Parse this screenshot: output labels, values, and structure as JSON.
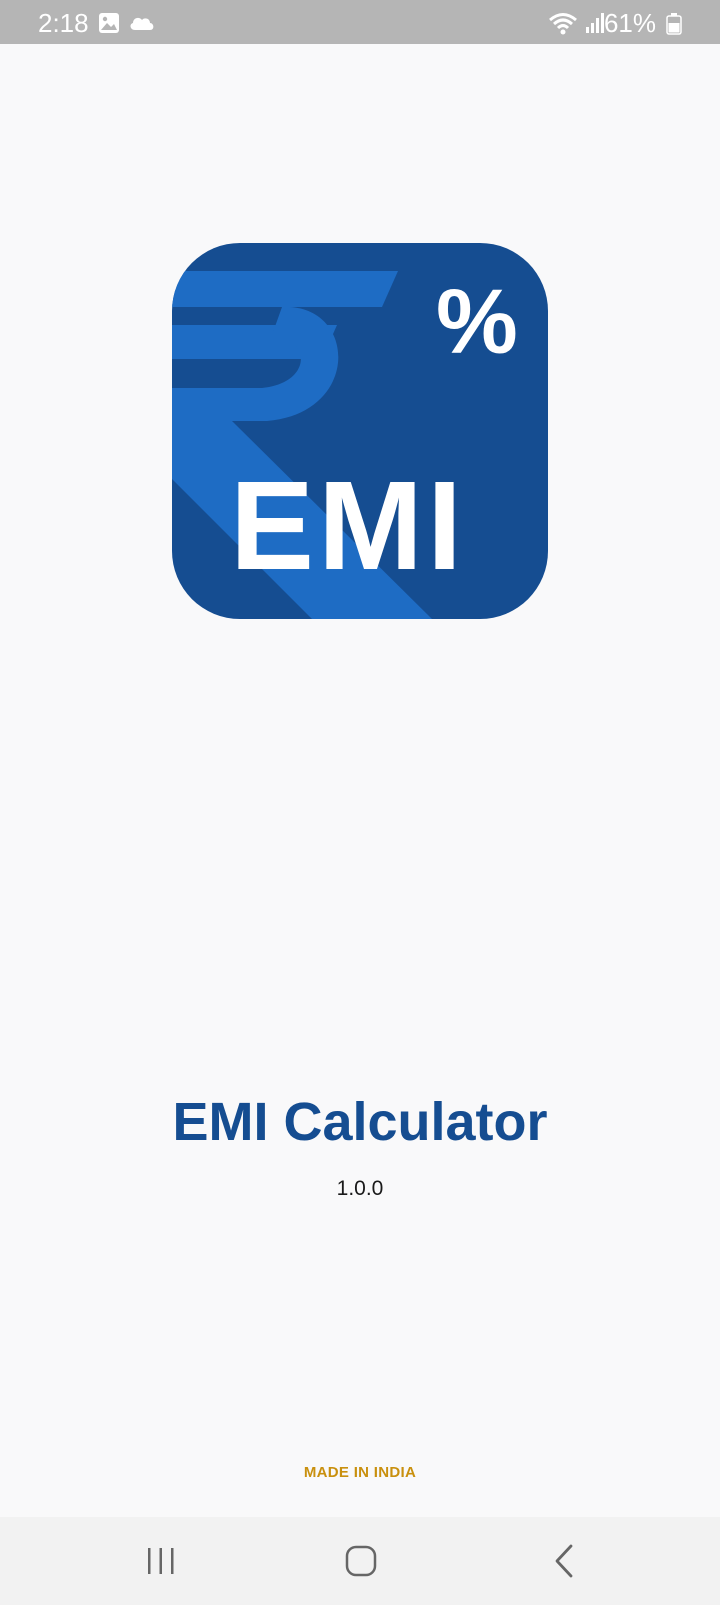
{
  "status_bar": {
    "time": "2:18",
    "battery_text": "61%",
    "icons": [
      "image-icon",
      "cloud-icon",
      "wifi-icon",
      "signal-icon",
      "battery-icon"
    ]
  },
  "splash": {
    "logo_text": "EMI",
    "logo_symbol": "%",
    "title": "EMI Calculator",
    "version": "1.0.0",
    "footer": "MADE IN INDIA"
  },
  "colors": {
    "brand_blue": "#154d91",
    "logo_light_blue": "#1e6cc4",
    "footer_gold": "#c9900e"
  },
  "nav_bar": {
    "buttons": [
      "recent-apps",
      "home",
      "back"
    ]
  }
}
